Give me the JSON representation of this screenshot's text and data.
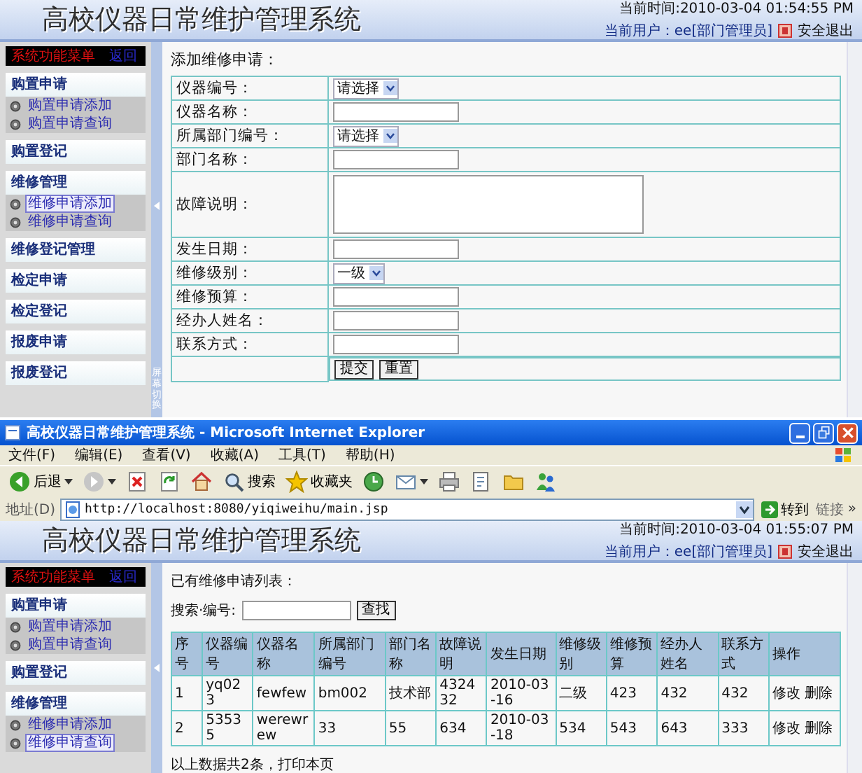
{
  "top_app": {
    "header": {
      "title": "高校仪器日常维护管理系统",
      "time": "当前时间:2010-03-04 01:54:55 PM",
      "user": "当前用户：ee[部门管理员]",
      "logout": "安全退出"
    },
    "sidebar": {
      "menu_title": "系统功能菜单",
      "back": "返回",
      "groups": [
        {
          "label": "购置申请",
          "children": [
            {
              "label": "购置申请添加",
              "selected": false
            },
            {
              "label": "购置申请查询",
              "selected": false
            }
          ]
        },
        {
          "label": "购置登记"
        },
        {
          "label": "维修管理",
          "children": [
            {
              "label": "维修申请添加",
              "selected": true
            },
            {
              "label": "维修申请查询",
              "selected": false
            }
          ]
        },
        {
          "label": "维修登记管理"
        },
        {
          "label": "检定申请"
        },
        {
          "label": "检定登记"
        },
        {
          "label": "报废申请"
        },
        {
          "label": "报废登记"
        }
      ]
    },
    "splitter_label": "屏幕切换",
    "form": {
      "title": "添加维修申请：",
      "rows": [
        {
          "label": "仪器编号：",
          "kind": "select",
          "value": "请选择"
        },
        {
          "label": "仪器名称：",
          "kind": "input"
        },
        {
          "label": "所属部门编号：",
          "kind": "select",
          "value": "请选择"
        },
        {
          "label": "部门名称：",
          "kind": "input"
        },
        {
          "label": "故障说明：",
          "kind": "textarea"
        },
        {
          "label": "发生日期：",
          "kind": "input"
        },
        {
          "label": "维修级别：",
          "kind": "select",
          "value": "一级"
        },
        {
          "label": "维修预算：",
          "kind": "input"
        },
        {
          "label": "经办人姓名：",
          "kind": "input"
        },
        {
          "label": "联系方式：",
          "kind": "input"
        }
      ],
      "buttons": [
        "提交",
        "重置"
      ]
    }
  },
  "ie_window": {
    "title": "高校仪器日常维护管理系统 - Microsoft Internet Explorer",
    "menu": [
      "文件(F)",
      "编辑(E)",
      "查看(V)",
      "收藏(A)",
      "工具(T)",
      "帮助(H)"
    ],
    "toolbar": [
      {
        "kind": "back",
        "label": "后退"
      },
      {
        "kind": "forward"
      },
      {
        "kind": "stop"
      },
      {
        "kind": "refresh"
      },
      {
        "kind": "home"
      },
      {
        "kind": "search",
        "label": "搜索"
      },
      {
        "kind": "favorites",
        "label": "收藏夹"
      },
      {
        "kind": "history"
      },
      {
        "kind": "mail"
      },
      {
        "kind": "print"
      },
      {
        "kind": "edit"
      },
      {
        "kind": "folder"
      },
      {
        "kind": "messenger"
      }
    ],
    "address_label": "地址(D)",
    "url": "http://localhost:8080/yiqiweihu/main.jsp",
    "go": "转到",
    "links": "链接",
    "links_more": "»"
  },
  "bottom_app": {
    "header": {
      "title": "高校仪器日常维护管理系统",
      "time": "当前时间:2010-03-04 01:55:07 PM",
      "user": "当前用户：ee[部门管理员]",
      "logout": "安全退出"
    },
    "sidebar": {
      "menu_title": "系统功能菜单",
      "back": "返回",
      "groups": [
        {
          "label": "购置申请",
          "children": [
            {
              "label": "购置申请添加",
              "selected": false
            },
            {
              "label": "购置申请查询",
              "selected": false
            }
          ]
        },
        {
          "label": "购置登记"
        },
        {
          "label": "维修管理",
          "children": [
            {
              "label": "维修申请添加",
              "selected": false
            },
            {
              "label": "维修申请查询",
              "selected": true
            }
          ]
        }
      ]
    },
    "list": {
      "title": "已有维修申请列表：",
      "search_label": "搜索·编号:",
      "search_button": "查找",
      "columns": [
        "序号",
        "仪器编号",
        "仪器名称",
        "所属部门编号",
        "部门名称",
        "故障说明",
        "发生日期",
        "维修级别",
        "维修预算",
        "经办人姓名",
        "联系方式",
        "操作"
      ],
      "rows": [
        {
          "cells": [
            "1",
            "yq023",
            "fewfew",
            "bm002",
            "技术部",
            "432432",
            "2010-03-16",
            "二级",
            "423",
            "432",
            "432"
          ],
          "actions": [
            "修改",
            "删除"
          ]
        },
        {
          "cells": [
            "2",
            "53535",
            "werewrew",
            "33",
            "55",
            "634",
            "2010-03-18",
            "534",
            "543",
            "643",
            "333"
          ],
          "actions": [
            "修改",
            "删除"
          ]
        }
      ],
      "footer": "以上数据共2条，打印本页"
    }
  }
}
